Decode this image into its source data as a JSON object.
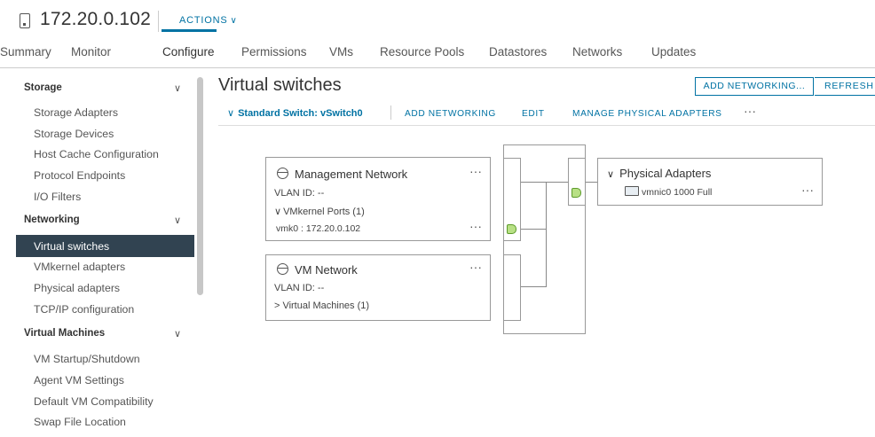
{
  "header": {
    "title": "172.20.0.102",
    "actions_label": "ACTIONS"
  },
  "tabs": [
    {
      "label": "Summary"
    },
    {
      "label": "Monitor"
    },
    {
      "label": "Configure"
    },
    {
      "label": "Permissions"
    },
    {
      "label": "VMs"
    },
    {
      "label": "Resource Pools"
    },
    {
      "label": "Datastores"
    },
    {
      "label": "Networks"
    },
    {
      "label": "Updates"
    }
  ],
  "sidebar": {
    "sections": [
      {
        "label": "Storage",
        "items": [
          {
            "label": "Storage Adapters"
          },
          {
            "label": "Storage Devices"
          },
          {
            "label": "Host Cache Configuration"
          },
          {
            "label": "Protocol Endpoints"
          },
          {
            "label": "I/O Filters"
          }
        ]
      },
      {
        "label": "Networking",
        "items": [
          {
            "label": "Virtual switches"
          },
          {
            "label": "VMkernel adapters"
          },
          {
            "label": "Physical adapters"
          },
          {
            "label": "TCP/IP configuration"
          }
        ]
      },
      {
        "label": "Virtual Machines",
        "items": [
          {
            "label": "VM Startup/Shutdown"
          },
          {
            "label": "Agent VM Settings"
          },
          {
            "label": "Default VM Compatibility"
          },
          {
            "label": "Swap File Location"
          }
        ]
      }
    ]
  },
  "main": {
    "title": "Virtual switches",
    "buttons": {
      "add_networking": "ADD NETWORKING...",
      "refresh": "REFRESH"
    },
    "switch": {
      "name": "Standard Switch: vSwitch0",
      "actions": {
        "add_networking": "ADD NETWORKING",
        "edit": "EDIT",
        "manage": "MANAGE PHYSICAL ADAPTERS",
        "more": "···"
      }
    },
    "port_groups": [
      {
        "name": "Management Network",
        "vlan": "VLAN ID: --",
        "ports_label": "VMkernel Ports (1)",
        "port_entry": "vmk0 : 172.20.0.102",
        "more": "···"
      },
      {
        "name": "VM Network",
        "vlan": "VLAN ID: --",
        "vms_label": "Virtual Machines (1)",
        "more": "···"
      }
    ],
    "physical_adapters": {
      "label": "Physical Adapters",
      "nic": "vmnic0 1000 Full",
      "more": "···"
    }
  },
  "colors": {
    "accent": "#0072a3",
    "sidebar_selected": "#314351",
    "port_green": "#b8e085"
  }
}
